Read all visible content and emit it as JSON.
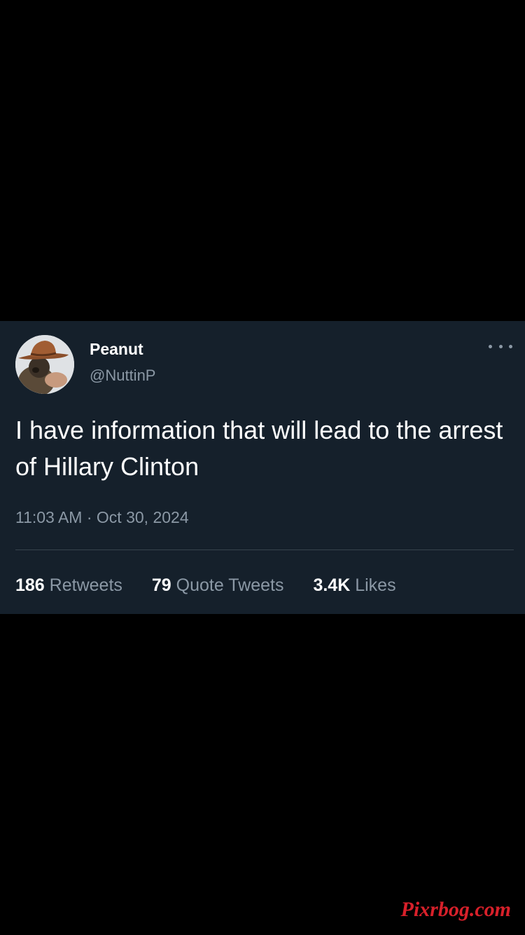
{
  "tweet": {
    "author": {
      "display_name": "Peanut",
      "handle": "@NuttinP",
      "avatar_description": "avatar-photo"
    },
    "more_icon": "more-horizontal-icon",
    "text": "I have information that will lead to the arrest of Hillary Clinton",
    "timestamp": "11:03 AM · Oct 30, 2024",
    "stats": {
      "retweets": {
        "count": "186",
        "label": "Retweets"
      },
      "quote_tweets": {
        "count": "79",
        "label": "Quote Tweets"
      },
      "likes": {
        "count": "3.4K",
        "label": "Likes"
      }
    }
  },
  "watermark": "Pixrbog.com",
  "colors": {
    "page_background": "#000000",
    "card_background": "#15202b",
    "primary_text": "#ffffff",
    "secondary_text": "#8b98a5",
    "divider": "#38444d",
    "watermark": "#d8202a"
  }
}
